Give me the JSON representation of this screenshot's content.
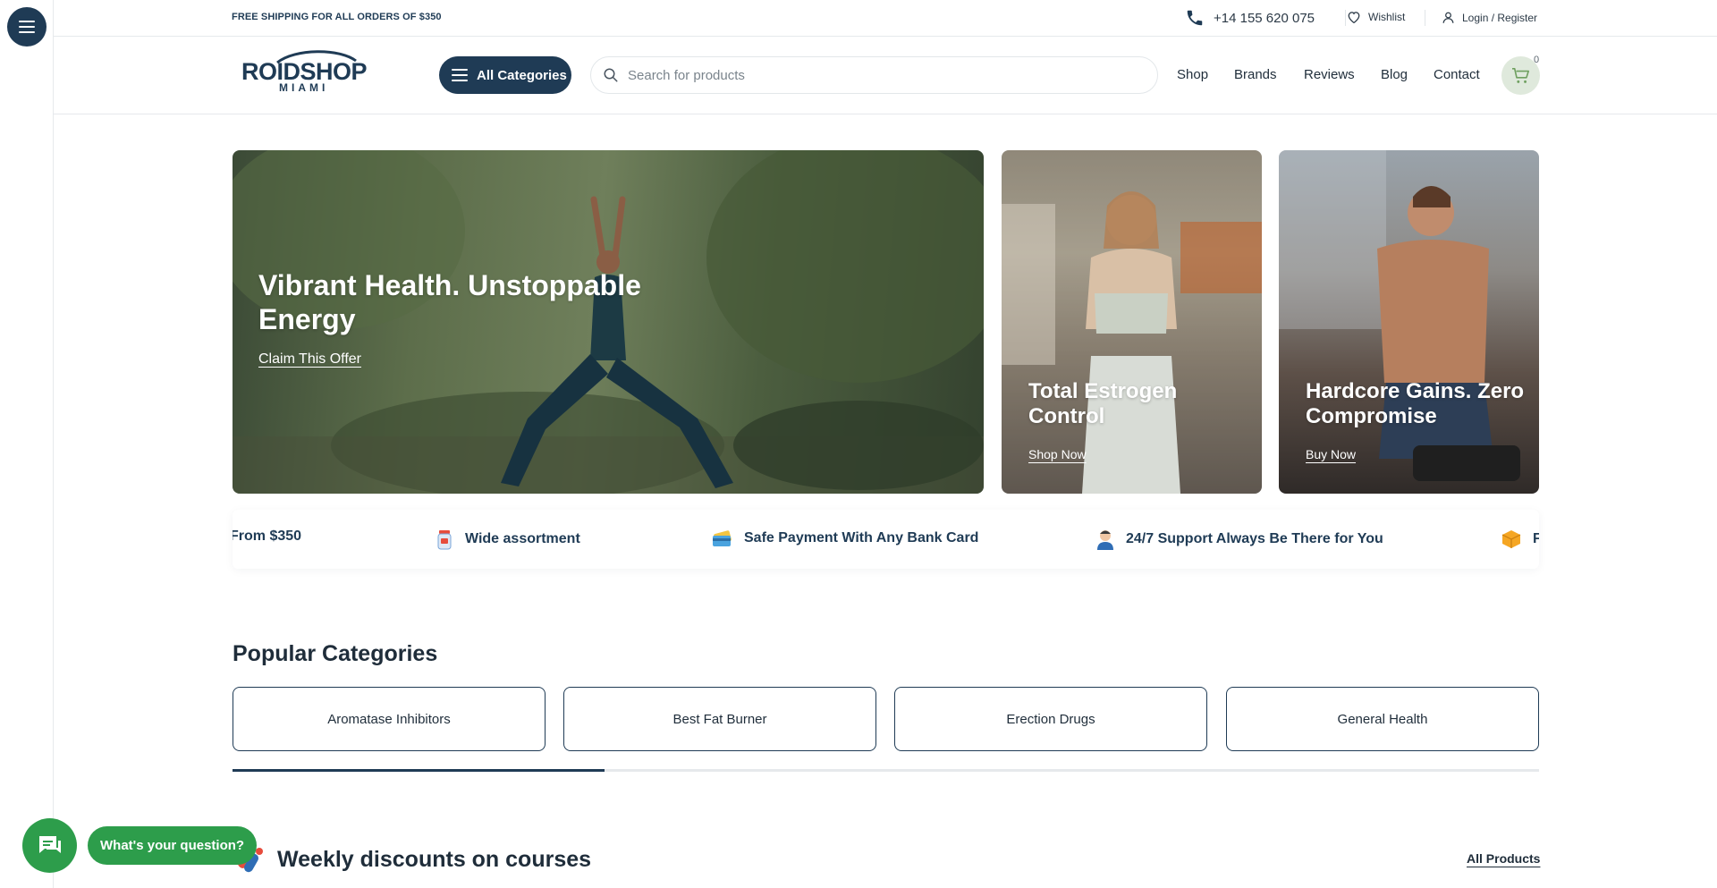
{
  "topbar": {
    "promo": "FREE SHIPPING FOR ALL ORDERS OF $350",
    "phone": "+14 155 620 075",
    "wishlist": "Wishlist",
    "login": "Login / Register"
  },
  "header": {
    "logo_text_main": "ROIDSHOP",
    "logo_text_sub": "MIAMI",
    "all_categories": "All Categories",
    "search_placeholder": "Search for products",
    "nav": [
      "Shop",
      "Brands",
      "Reviews",
      "Blog",
      "Contact"
    ],
    "cart_count": "0"
  },
  "banners": [
    {
      "title": "Vibrant Health. Unstoppable Energy",
      "link": "Claim This Offer"
    },
    {
      "title": "Total Estrogen Control",
      "link": "Shop Now"
    },
    {
      "title": "Hardcore Gains. Zero Compromise",
      "link": "Buy Now"
    }
  ],
  "features": {
    "items": [
      {
        "label": "From $350",
        "icon": "shipping-icon"
      },
      {
        "label": "Wide assortment",
        "icon": "medicine-bottle-icon"
      },
      {
        "label": "Safe Payment With Any Bank Card",
        "icon": "credit-card-icon"
      },
      {
        "label": "24/7 Support Always Be There for You",
        "icon": "support-agent-icon"
      },
      {
        "label": "Fr",
        "icon": "package-icon"
      }
    ]
  },
  "popular": {
    "title": "Popular Categories",
    "categories": [
      "Aromatase Inhibitors",
      "Best Fat Burner",
      "Erection Drugs",
      "General Health"
    ],
    "progress": 0.285
  },
  "weekly": {
    "title": "Weekly discounts on courses",
    "all_products": "All Products"
  },
  "chat": {
    "label": "What's your question?"
  },
  "colors": {
    "primary": "#1f3b55",
    "accent_green": "#2d9d4b",
    "cart_bg": "#dfe9dc"
  }
}
